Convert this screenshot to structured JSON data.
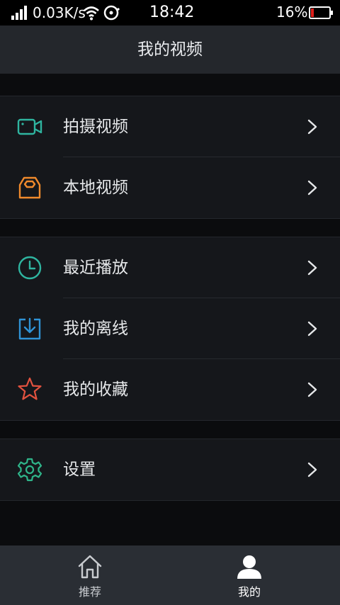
{
  "status_bar": {
    "net_speed": "0.03K/s",
    "time": "18:42",
    "battery_pct": "16%",
    "battery_level": 0.16
  },
  "header": {
    "title": "我的视频"
  },
  "menu": {
    "groups": [
      {
        "items": [
          {
            "label": "拍摄视频",
            "icon": "video-camera-icon",
            "color": "#2fb5a0"
          },
          {
            "label": "本地视频",
            "icon": "local-box-icon",
            "color": "#f08a2c"
          }
        ]
      },
      {
        "items": [
          {
            "label": "最近播放",
            "icon": "clock-icon",
            "color": "#2fb5a0"
          },
          {
            "label": "我的离线",
            "icon": "download-icon",
            "color": "#2f93d6"
          },
          {
            "label": "我的收藏",
            "icon": "star-icon",
            "color": "#e3523f"
          }
        ]
      },
      {
        "items": [
          {
            "label": "设置",
            "icon": "gear-icon",
            "color": "#2fb58a"
          }
        ]
      }
    ]
  },
  "tab_bar": {
    "tabs": [
      {
        "label": "推荐",
        "icon": "home-icon",
        "active": false
      },
      {
        "label": "我的",
        "icon": "user-icon",
        "active": true
      }
    ]
  }
}
